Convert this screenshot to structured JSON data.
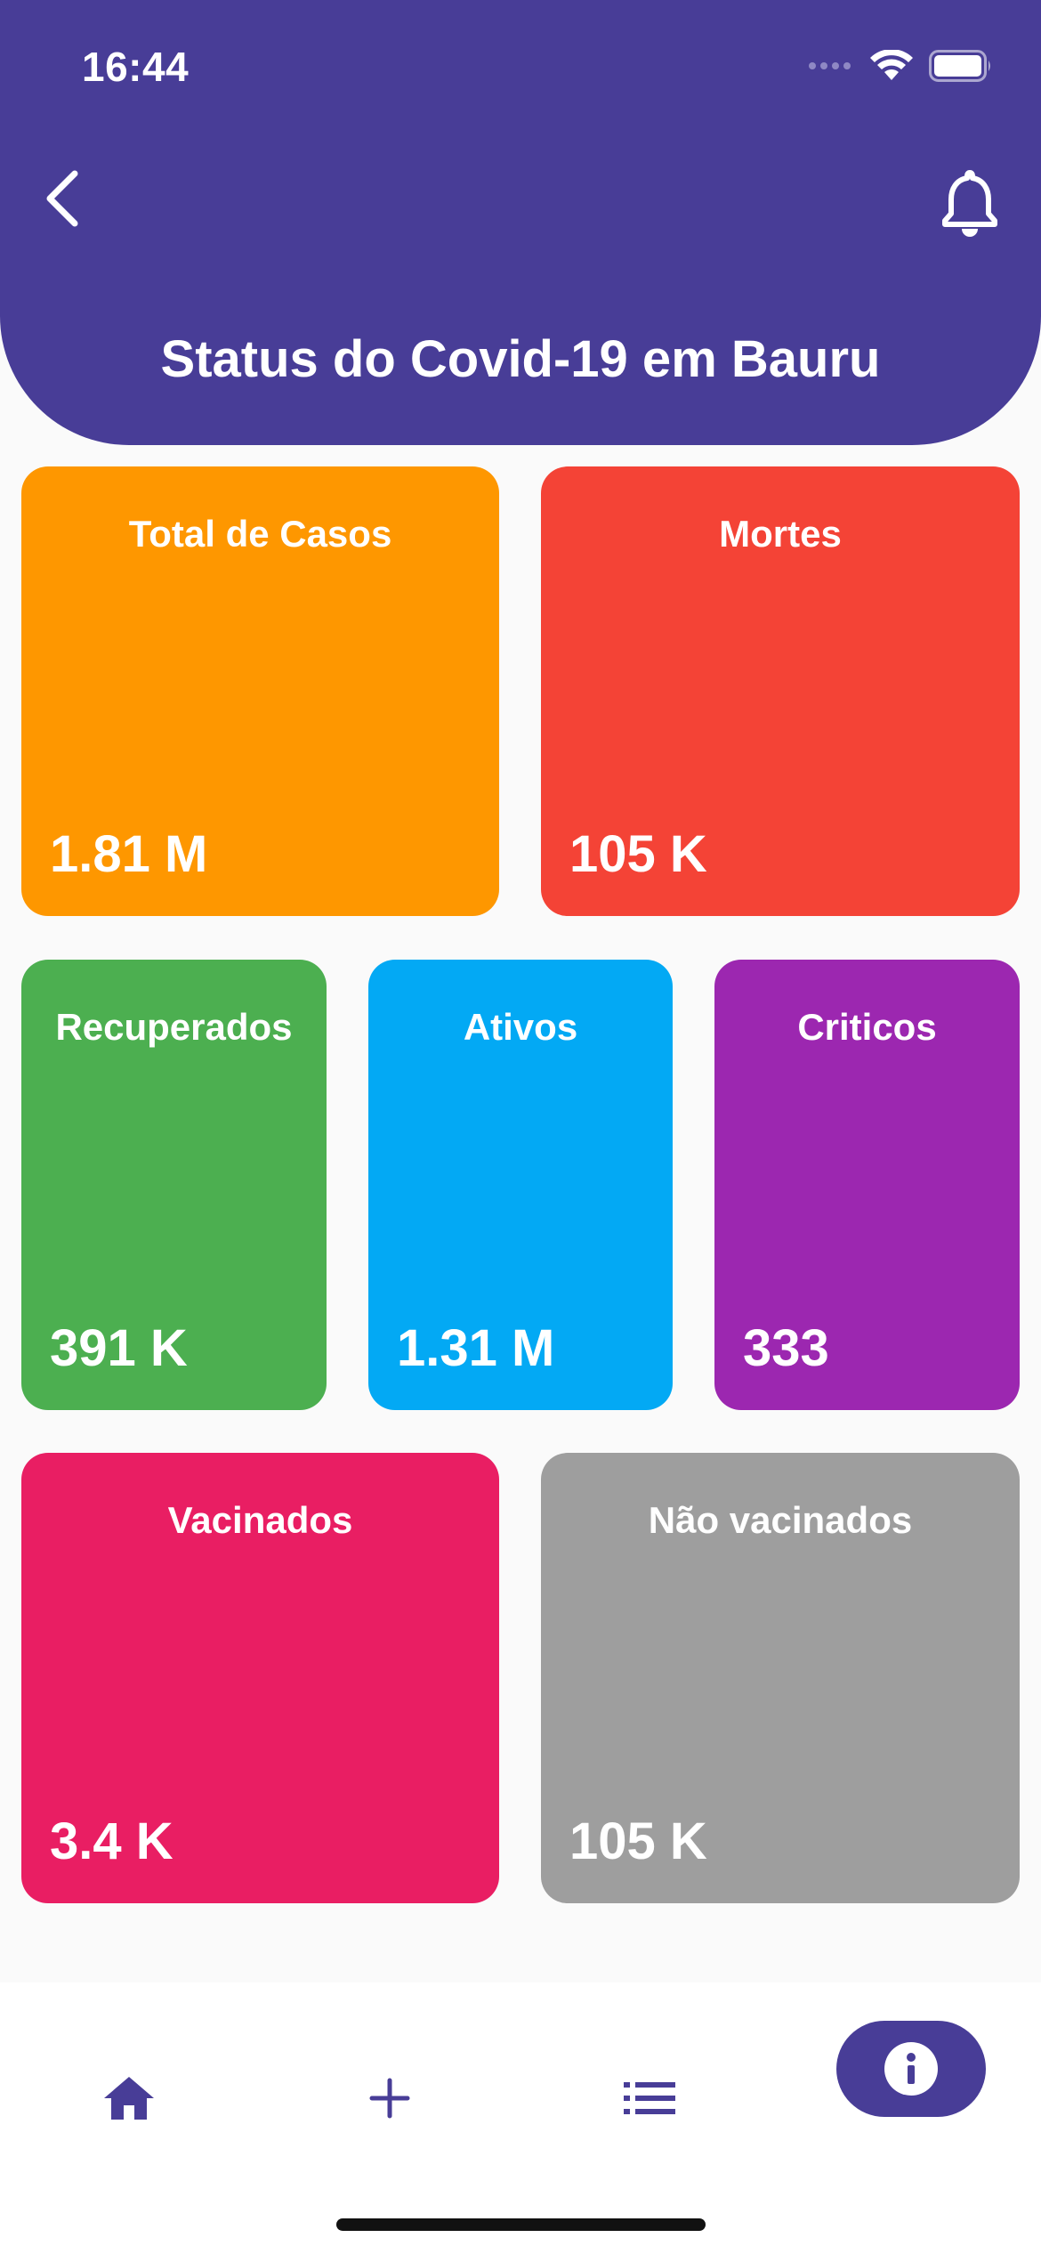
{
  "status_bar": {
    "time": "16:44"
  },
  "header": {
    "title": "Status do Covid-19 em Bauru",
    "background_color": "#483D97"
  },
  "stats": {
    "total_casos": {
      "label": "Total de Casos",
      "value": "1.81 M",
      "color": "#FE9700"
    },
    "mortes": {
      "label": "Mortes",
      "value": "105 K",
      "color": "#F44336"
    },
    "recuperados": {
      "label": "Recuperados",
      "value": "391 K",
      "color": "#4CAF50"
    },
    "ativos": {
      "label": "Ativos",
      "value": "1.31 M",
      "color": "#03A9F4"
    },
    "criticos": {
      "label": "Criticos",
      "value": "333",
      "color": "#9C27B0"
    },
    "vacinados": {
      "label": "Vacinados",
      "value": "3.4 K",
      "color": "#E91E63"
    },
    "nao_vacinados": {
      "label": "Não vacinados",
      "value": "105 K",
      "color": "#9E9E9E"
    }
  },
  "bottom_nav": {
    "items": [
      {
        "icon": "home-icon",
        "active": false
      },
      {
        "icon": "add-icon",
        "active": false
      },
      {
        "icon": "list-icon",
        "active": false
      },
      {
        "icon": "info-icon",
        "active": true
      }
    ],
    "accent_color": "#483D97"
  }
}
